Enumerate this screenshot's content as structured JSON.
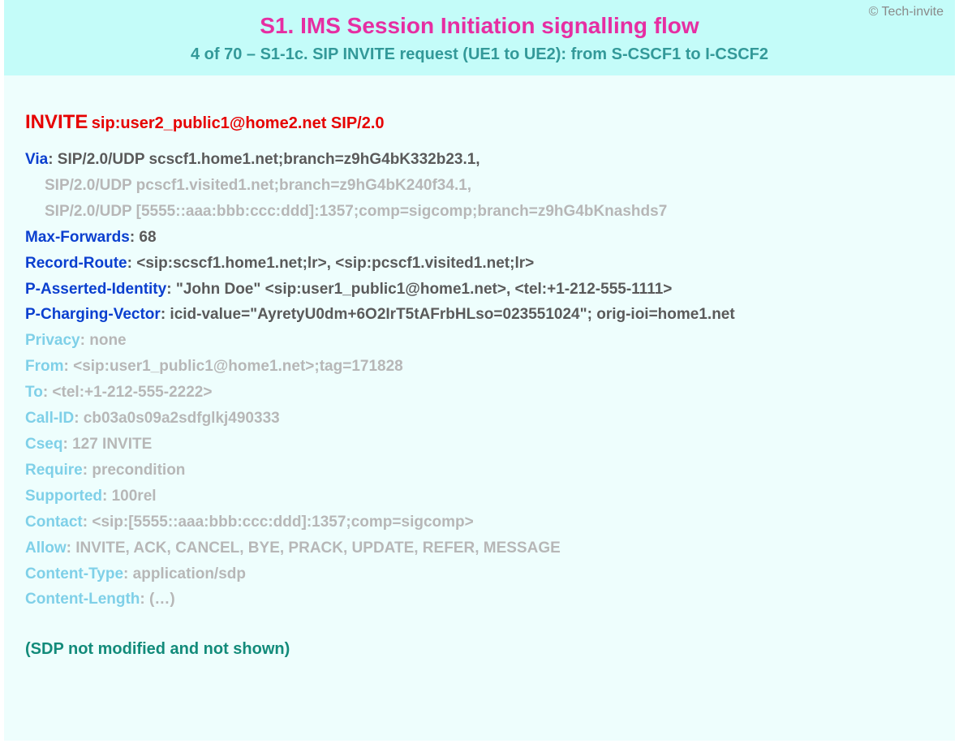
{
  "copyright": "© Tech-invite",
  "title": "S1. IMS Session Initiation signalling flow",
  "subtitle": "4 of 70 – S1-1c. SIP INVITE request (UE1 to UE2): from S-CSCF1 to I-CSCF2",
  "invite": {
    "method": "INVITE",
    "request_uri": "sip:user2_public1@home2.net SIP/2.0"
  },
  "via": {
    "name": "Via",
    "first": "SIP/2.0/UDP scscf1.home1.net;branch=z9hG4bK332b23.1,",
    "cont1": "SIP/2.0/UDP pcscf1.visited1.net;branch=z9hG4bK240f34.1,",
    "cont2": "SIP/2.0/UDP [5555::aaa:bbb:ccc:ddd]:1357;comp=sigcomp;branch=z9hG4bKnashds7"
  },
  "headers_strong": [
    {
      "name": "Max-Forwards",
      "value": "68"
    },
    {
      "name": "Record-Route",
      "value": "<sip:scscf1.home1.net;lr>, <sip:pcscf1.visited1.net;lr>"
    },
    {
      "name": "P-Asserted-Identity",
      "value": "\"John Doe\" <sip:user1_public1@home1.net>, <tel:+1-212-555-1111>"
    },
    {
      "name": "P-Charging-Vector",
      "value": "icid-value=\"AyretyU0dm+6O2IrT5tAFrbHLso=023551024\"; orig-ioi=home1.net"
    }
  ],
  "headers_dim": [
    {
      "name": "Privacy",
      "value": "none"
    },
    {
      "name": "From",
      "value": "<sip:user1_public1@home1.net>;tag=171828"
    },
    {
      "name": "To",
      "value": "<tel:+1-212-555-2222>"
    },
    {
      "name": "Call-ID",
      "value": "cb03a0s09a2sdfglkj490333"
    },
    {
      "name": "Cseq",
      "value": "127 INVITE"
    },
    {
      "name": "Require",
      "value": "precondition"
    },
    {
      "name": "Supported",
      "value": "100rel"
    },
    {
      "name": "Contact",
      "value": "<sip:[5555::aaa:bbb:ccc:ddd]:1357;comp=sigcomp>"
    },
    {
      "name": "Allow",
      "value": "INVITE, ACK, CANCEL, BYE, PRACK, UPDATE, REFER, MESSAGE"
    },
    {
      "name": "Content-Type",
      "value": "application/sdp"
    },
    {
      "name": "Content-Length",
      "value": "(…)"
    }
  ],
  "sdp_note": "(SDP not modified and not shown)"
}
